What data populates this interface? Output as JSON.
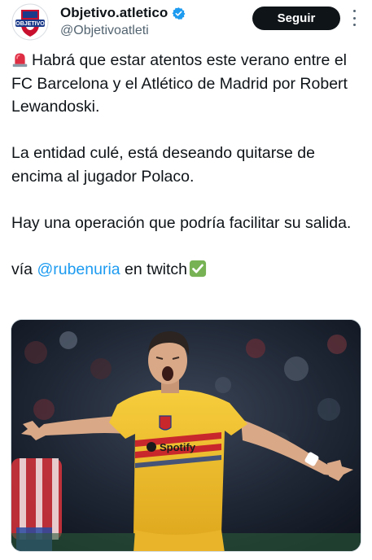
{
  "account": {
    "display_name": "Objetivo.atletico",
    "handle": "@Objetivoatleti",
    "avatar_text": "OBJETIVO",
    "verified": true
  },
  "actions": {
    "follow_label": "Seguir"
  },
  "tweet": {
    "line1": "Habrá que estar atentos este verano entre el FC Barcelona y el Atlético de Madrid por Robert Lewandoski.",
    "line2": "La entidad culé, está deseando quitarse de encima al jugador Polaco.",
    "line3": "Hay una operación que podría facilitar su salida.",
    "via_prefix": "vía ",
    "mention": "@rubenuria",
    "via_suffix": " en twitch"
  },
  "media": {
    "jersey_brand": "Spotify"
  },
  "icons": {
    "leading": "rotating-light-emoji",
    "trailing": "check-mark-button-emoji",
    "verified": "verified-badge-icon",
    "more": "more-options-icon"
  },
  "colors": {
    "accent": "#1d9bf0",
    "follow_bg": "#0f1419",
    "jersey": "#f2c12e",
    "stripe": "#c8272b"
  }
}
